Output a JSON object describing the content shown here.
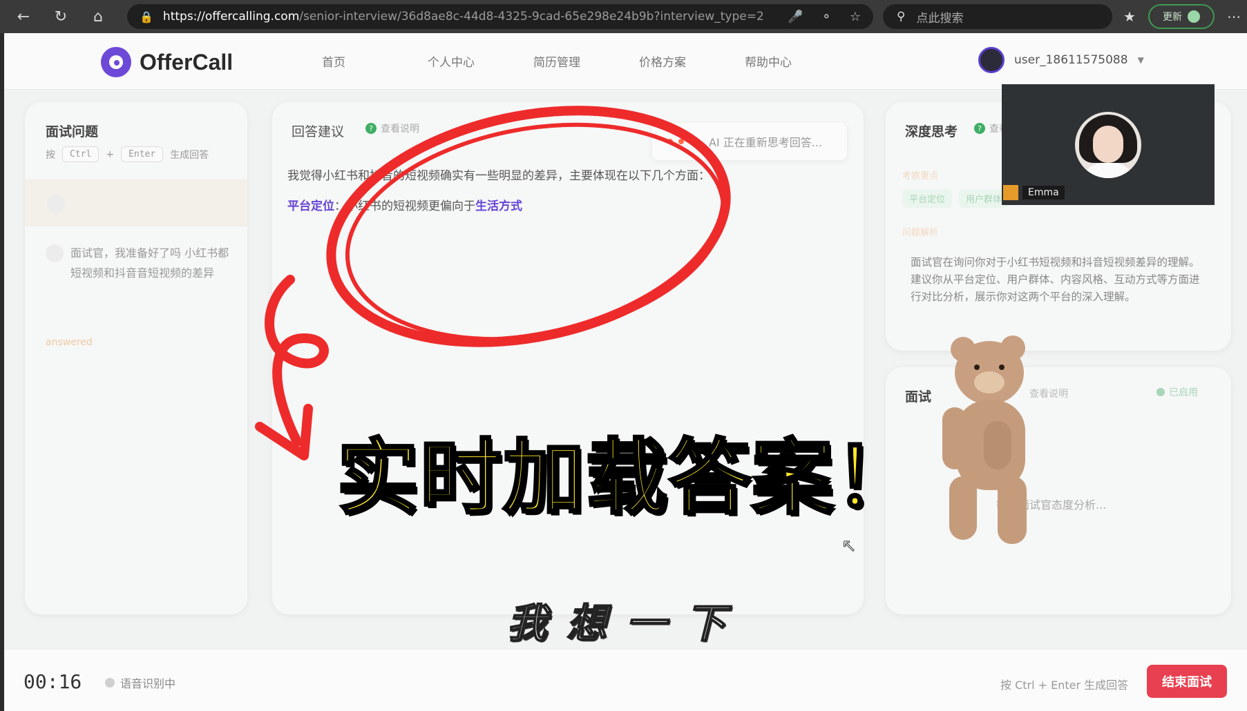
{
  "browser": {
    "url_host": "https://offercalling.com",
    "url_path": "/senior-interview/36d8ae8c-44d8-4325-9cad-65e298e24b9b?interview_type=2",
    "search_placeholder": "点此搜索",
    "update_label": "更新"
  },
  "app": {
    "brand": "OfferCall",
    "nav": [
      "首页",
      "个人中心",
      "简历管理",
      "价格方案",
      "帮助中心"
    ],
    "user": "user_18611575088"
  },
  "questions_panel": {
    "title": "面试问题",
    "hint_prefix": "按",
    "key1": "Ctrl",
    "plus": "+",
    "key2": "Enter",
    "hint_suffix": "生成回答",
    "item_text": "面试官，我准备好了吗 小红书都短视频和抖音音短视频的差异",
    "item_status": "answered"
  },
  "answer_panel": {
    "title": "回答建议",
    "hint": "查看说明",
    "thinking": "AI 正在重新思考回答...",
    "p1": "我觉得小红书和抖音的短视频确实有一些明显的差异，主要体现在以下几个方面：",
    "p2_label": "平台定位",
    "p2_text": "：小红书的短视频更偏向于",
    "p2_highlight": "生活方式"
  },
  "deep_panel": {
    "title": "深度思考",
    "hint": "查看说明",
    "faint1": "考察重点",
    "tags": [
      "平台定位",
      "用户群体"
    ],
    "faint2": "问题解析",
    "desc": "面试官在询问你对于小红书短视频和抖音短视频差异的理解。建议你从平台定位、用户群体、内容风格、互动方式等方面进行对比分析，展示你对这两个平台的深入理解。"
  },
  "attitude_panel": {
    "title": "面试",
    "hint": "查看说明",
    "status": "已启用",
    "waiting": "等待面试官态度分析..."
  },
  "video": {
    "name": "Emma"
  },
  "bottom": {
    "timer": "00:16",
    "asr": "语音识别中",
    "hint": "按 Ctrl + Enter 生成回答",
    "end_button": "结束面试"
  },
  "overlay": {
    "caption": "实时加载答案！",
    "subtitle": "我想一下"
  }
}
